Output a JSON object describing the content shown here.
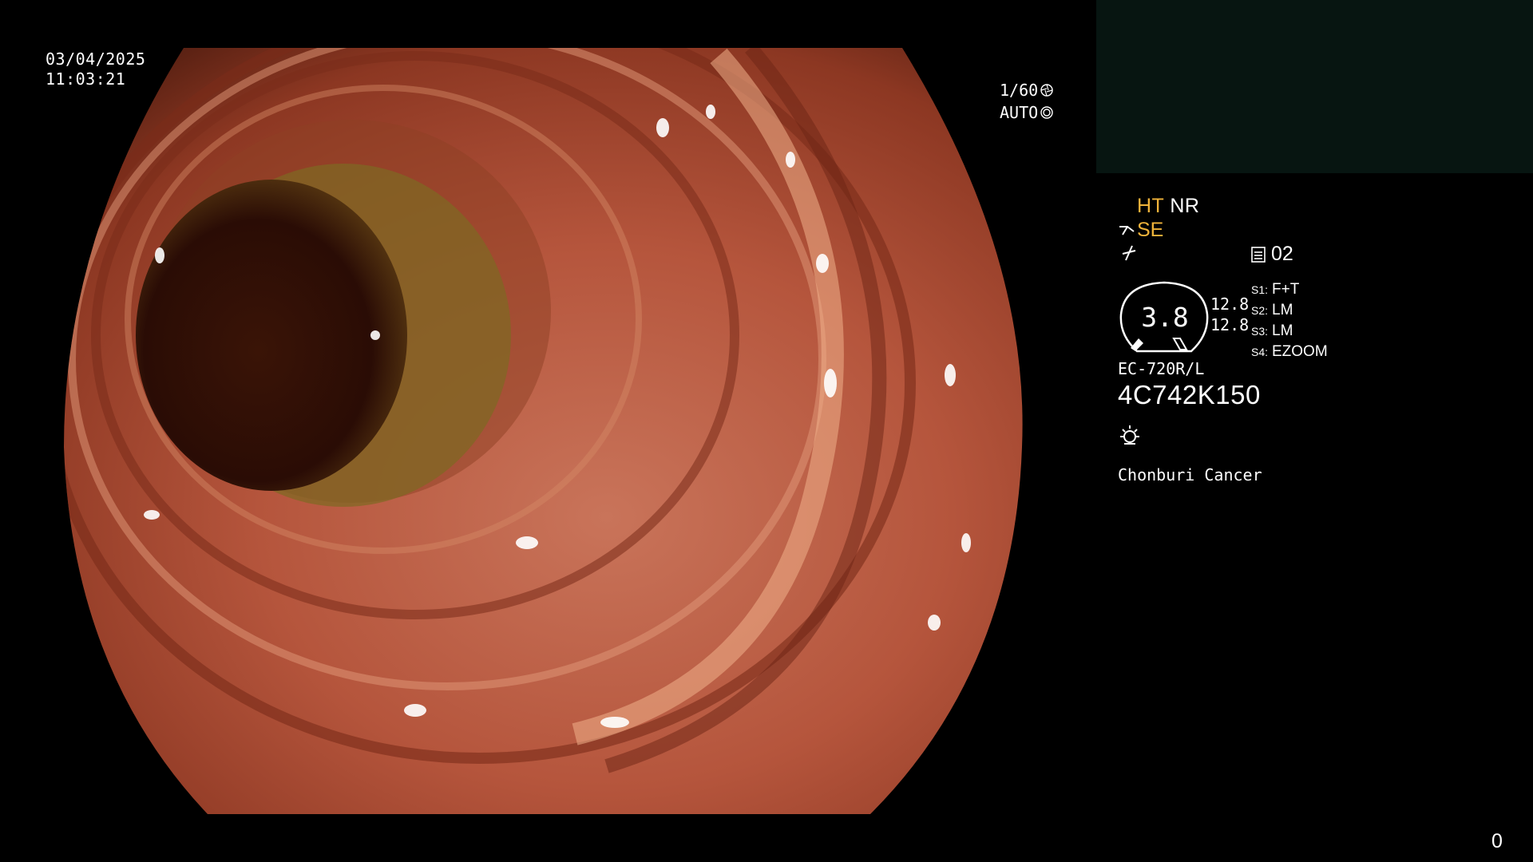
{
  "overlay": {
    "date": "03/04/2025",
    "time": "11:03:21",
    "shutter": "1/60",
    "iris": "AUTO"
  },
  "panel": {
    "mode_primary": "HT",
    "mode_secondary": "NR",
    "enhancement": "SE",
    "storage": "02",
    "gauge_value": "3.8",
    "gauge_side_1": "12.8",
    "gauge_side_2": "12.8",
    "settings": [
      {
        "key": "S1:",
        "value": "F+T"
      },
      {
        "key": "S2:",
        "value": "LM"
      },
      {
        "key": "S3:",
        "value": "LM"
      },
      {
        "key": "S4:",
        "value": "EZOOM"
      }
    ],
    "scope_model": "EC-720R/L",
    "scope_serial": "4C742K150",
    "institution": "Chonburi Cancer"
  },
  "footer": {
    "frame_counter": "0"
  },
  "colors": {
    "accent": "#f0b33a",
    "thumb_bg": "#071511",
    "mucosa": "#b9593f",
    "lumen": "#2a0c05"
  },
  "icons": {
    "shutter": "aperture-icon",
    "iris": "iris-icon",
    "scissor": "scissor-icon",
    "noise": "noise-filter-icon",
    "storage": "storage-icon",
    "light": "light-source-icon"
  }
}
